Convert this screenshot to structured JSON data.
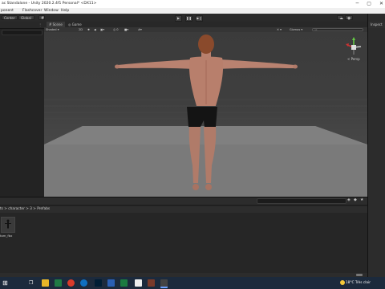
{
  "window": {
    "title": "ac Standalone - Unity 2020.2.4f1 Personal* <DX11>"
  },
  "menu": {
    "items": [
      "ponent",
      "Flashcover",
      "Window",
      "Help"
    ]
  },
  "toolbar": {
    "center_label": "Center",
    "global_label": "Global",
    "play_icon": "play-icon",
    "pause_icon": "pause-icon",
    "step_icon": "step-icon",
    "account_label": "Account"
  },
  "scene": {
    "tabs": [
      "Scene",
      "Game"
    ],
    "shading_mode": "Shaded",
    "mode_2d": "2D",
    "gizmos_label": "Gizmos",
    "search_placeholder": "All",
    "persp_label": "< Persp"
  },
  "inspector": {
    "title": "Inspect"
  },
  "project": {
    "breadcrumb": "ts > character > 3 > Prefabs",
    "asset_label": "tom_fbx"
  },
  "taskbar": {
    "temperature": "18°C",
    "weather": "Très clair"
  },
  "colors": {
    "accent": "#2d6ad6",
    "viewport_sky": "#3b3b3b",
    "ground": "#7a7a7a"
  }
}
